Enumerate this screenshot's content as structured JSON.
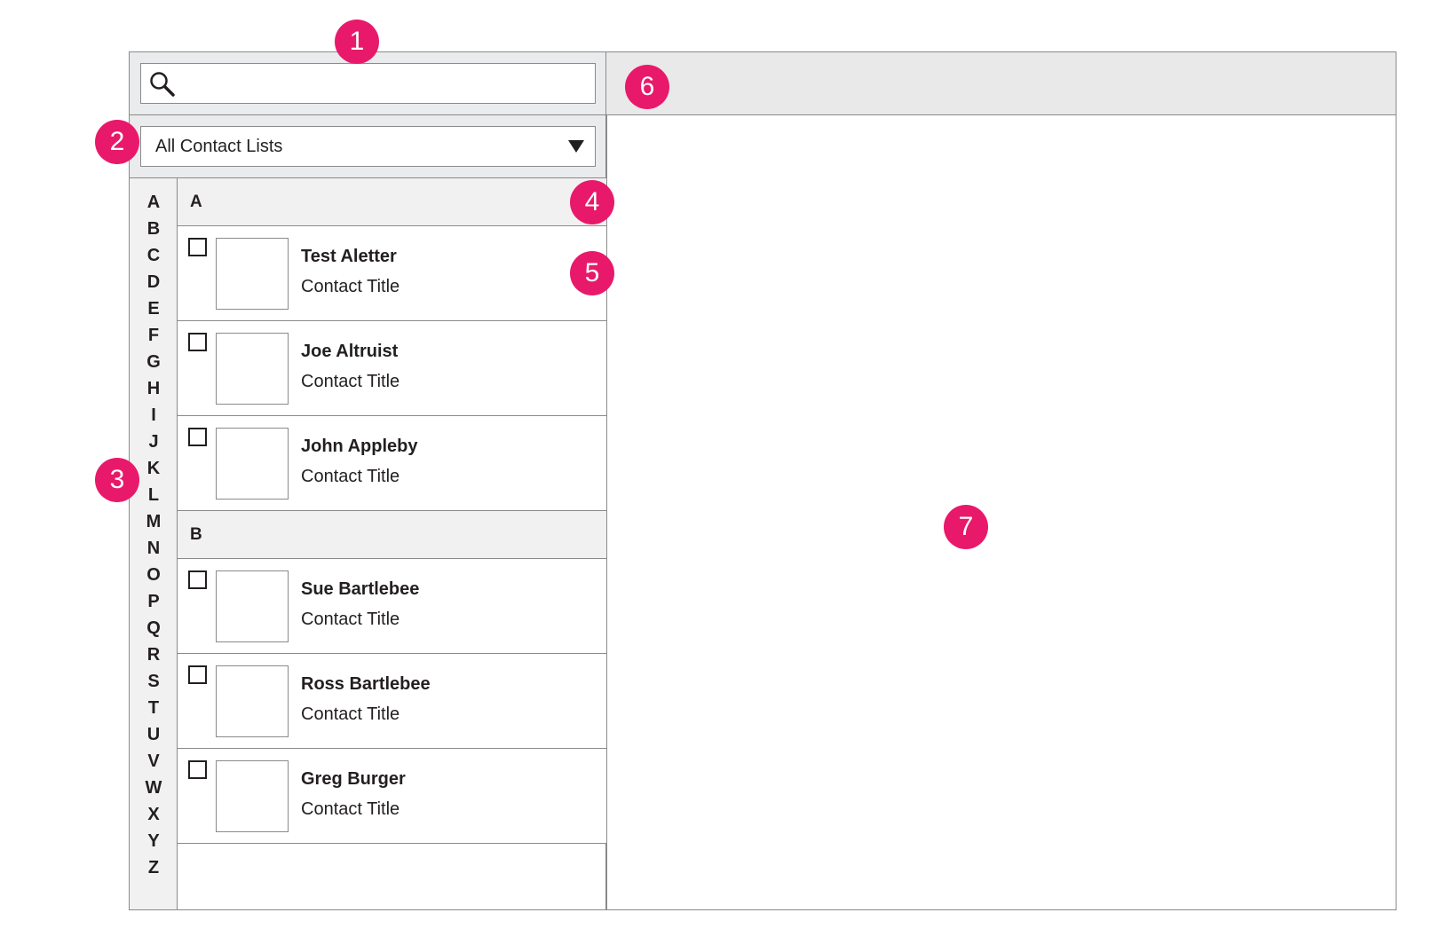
{
  "search": {
    "placeholder": ""
  },
  "filter": {
    "selected": "All Contact Lists"
  },
  "alphabet": [
    "A",
    "B",
    "C",
    "D",
    "E",
    "F",
    "G",
    "H",
    "I",
    "J",
    "K",
    "L",
    "M",
    "N",
    "O",
    "P",
    "Q",
    "R",
    "S",
    "T",
    "U",
    "V",
    "W",
    "X",
    "Y",
    "Z"
  ],
  "groups": [
    {
      "letter": "A",
      "contacts": [
        {
          "name": "Test Aletter",
          "title": "Contact Title"
        },
        {
          "name": "Joe Altruist",
          "title": "Contact Title"
        },
        {
          "name": "John Appleby",
          "title": "Contact Title"
        }
      ]
    },
    {
      "letter": "B",
      "contacts": [
        {
          "name": "Sue Bartlebee",
          "title": "Contact Title"
        },
        {
          "name": "Ross Bartlebee",
          "title": "Contact Title"
        },
        {
          "name": "Greg Burger",
          "title": "Contact Title"
        }
      ]
    }
  ],
  "annotations": [
    "1",
    "2",
    "3",
    "4",
    "5",
    "6",
    "7"
  ],
  "colors": {
    "annotation": "#e8196a",
    "panel": "#eaebec",
    "border": "#8a8a8a"
  }
}
